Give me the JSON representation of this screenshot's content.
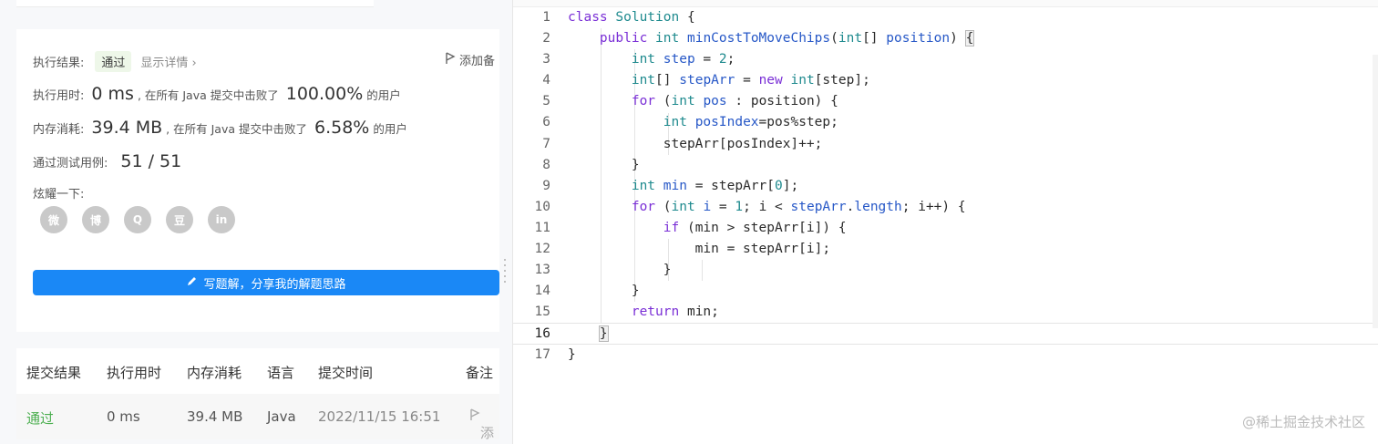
{
  "result": {
    "status_label": "执行结果:",
    "status_value": "通过",
    "detail_link": "显示详情 ›",
    "add_note": "添加备",
    "runtime_label": "执行用时:",
    "runtime_value": "0 ms",
    "runtime_mid": ", 在所有 Java 提交中击败了",
    "runtime_pct": "100.00%",
    "runtime_tail": "的用户",
    "memory_label": "内存消耗:",
    "memory_value": "39.4 MB",
    "memory_mid": ", 在所有 Java 提交中击败了",
    "memory_pct": "6.58%",
    "memory_tail": "的用户",
    "tests_label": "通过测试用例:",
    "tests_value": "51 / 51",
    "share_label": "炫耀一下:",
    "share_icons": [
      {
        "name": "wechat-icon",
        "glyph": "微"
      },
      {
        "name": "weibo-icon",
        "glyph": "博"
      },
      {
        "name": "qq-icon",
        "glyph": "Q"
      },
      {
        "name": "douban-icon",
        "glyph": "豆"
      },
      {
        "name": "linkedin-icon",
        "glyph": "in"
      }
    ],
    "write_button": "写题解，分享我的解题思路"
  },
  "submissions": {
    "headers": [
      "提交结果",
      "执行用时",
      "内存消耗",
      "语言",
      "提交时间",
      "备注"
    ],
    "rows": [
      {
        "result": "通过",
        "runtime": "0 ms",
        "memory": "39.4 MB",
        "language": "Java",
        "time": "2022/11/15 16:51",
        "note": "添"
      }
    ]
  },
  "colors": {
    "accent": "#1a88f6",
    "pass_green": "#4caf50",
    "keyword": "#7a2fd6",
    "type": "#1e8a8e",
    "identifier": "#2758c7"
  },
  "editor": {
    "line_numbers": [
      "1",
      "2",
      "3",
      "4",
      "5",
      "6",
      "7",
      "8",
      "9",
      "10",
      "11",
      "12",
      "13",
      "14",
      "15",
      "16",
      "17"
    ],
    "active_line": 16
  },
  "watermark": "@稀土掘金技术社区"
}
